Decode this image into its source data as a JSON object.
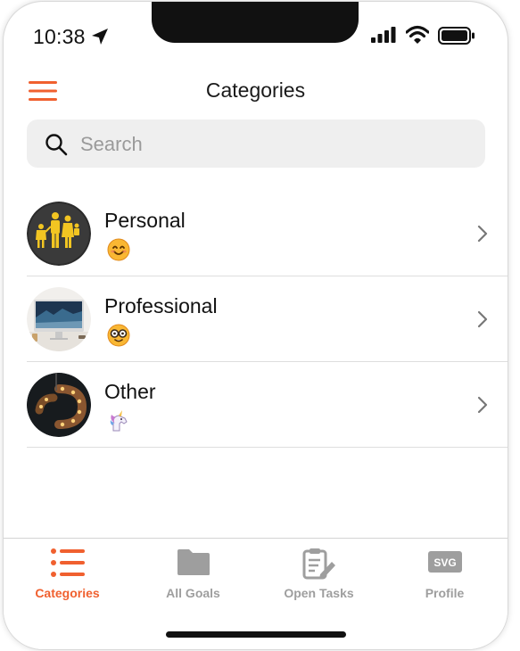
{
  "status_bar": {
    "time": "10:38",
    "icons": [
      "location-arrow-icon",
      "signal-icon",
      "wifi-icon",
      "battery-icon"
    ]
  },
  "header": {
    "title": "Categories",
    "menu_icon": "hamburger-menu-icon"
  },
  "search": {
    "placeholder": "Search",
    "value": "",
    "icon": "search-icon"
  },
  "categories": [
    {
      "title": "Personal",
      "emoji": "smiling-face-icon"
    },
    {
      "title": "Professional",
      "emoji": "nerd-face-icon"
    },
    {
      "title": "Other",
      "emoji": "unicorn-icon"
    }
  ],
  "tabbar": {
    "tabs": [
      {
        "label": "Categories",
        "icon": "list-icon",
        "active": true
      },
      {
        "label": "All Goals",
        "icon": "folder-icon",
        "active": false
      },
      {
        "label": "Open Tasks",
        "icon": "clipboard-edit-icon",
        "active": false
      },
      {
        "label": "Profile",
        "icon": "svg-placeholder-icon",
        "active": false
      }
    ],
    "placeholder_icon_text": "SVG"
  },
  "colors": {
    "accent": "#f0602f",
    "inactive": "#9e9e9e",
    "search_bg": "#efefef",
    "divider": "#dedede"
  }
}
